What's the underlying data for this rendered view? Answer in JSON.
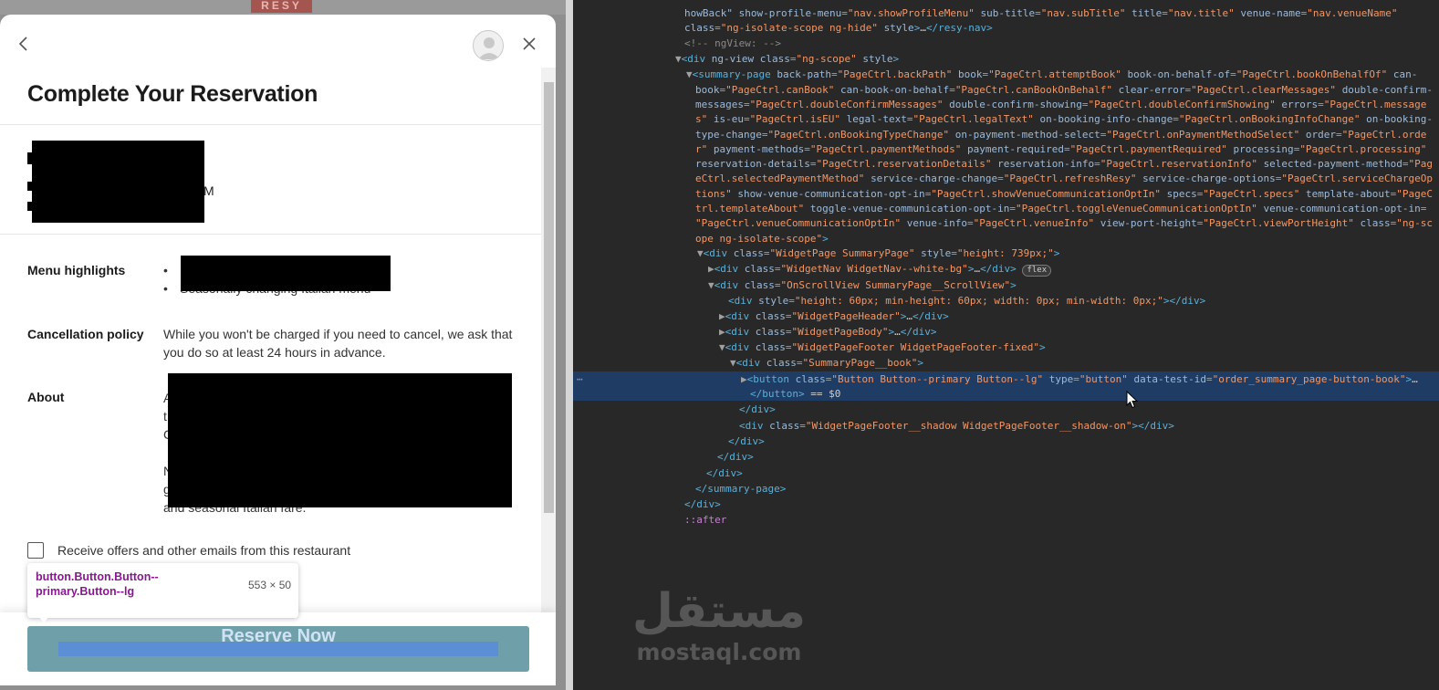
{
  "background_page": {
    "logo_text": "RESY"
  },
  "modal": {
    "title": "Complete Your Reservation",
    "res_time_fragment": "M",
    "menu_label": "Menu highlights",
    "menu_items": [
      "e",
      "Seasonally changing Italian menu"
    ],
    "cancel_label": "Cancellation policy",
    "cancel_text": "While you won't be charged if you need to cancel, we ask that you do so at least 24 hours in advance.",
    "about_label": "About",
    "about_fragments": [
      "A",
      "t",
      "C",
      "N",
      "g",
      "and seasonal Italian fare."
    ],
    "optin_label": "Receive offers and other emails from this restaurant",
    "reserve_label": "Reserve Now"
  },
  "tooltip": {
    "selector": "button.Button.Button--primary.Button--lg",
    "dimensions": "553 × 50"
  },
  "devtools": {
    "selected_suffix": "== $0",
    "badge": "flex",
    "pseudo": "::after"
  },
  "watermark": {
    "arabic": "مستقل",
    "latin": "mostaql.com"
  },
  "colors": {
    "reserve_button": "#6fa0a9",
    "devtools_bg": "#282828",
    "selected_row": "#1f3c64",
    "tooltip_selector": "#88188f"
  }
}
